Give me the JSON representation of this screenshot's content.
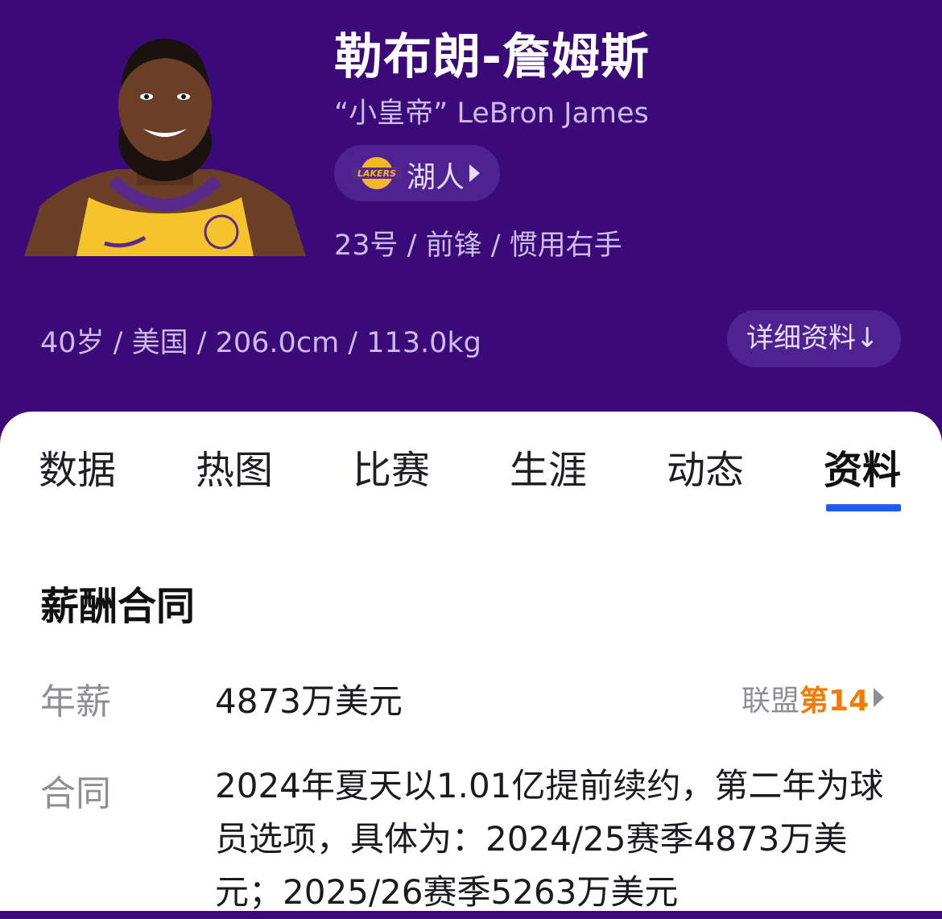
{
  "player": {
    "name": "勒布朗-詹姆斯",
    "nickname": "“小皇帝” LeBron James",
    "team": "湖人",
    "team_logo": "lakers-logo",
    "meta_position": "23号 / 前锋 / 惯用右手",
    "meta_bio": "40岁 / 美国 / 206.0cm / 113.0kg",
    "details_button": "详细资料↓"
  },
  "tabs": [
    {
      "label": "数据"
    },
    {
      "label": "热图"
    },
    {
      "label": "比赛"
    },
    {
      "label": "生涯"
    },
    {
      "label": "动态"
    },
    {
      "label": "资料",
      "active": true
    }
  ],
  "salary": {
    "section_title": "薪酬合同",
    "annual_label": "年薪",
    "annual_value": "4873万美元",
    "rank_prefix": "联盟",
    "rank_value": "第14",
    "contract_label": "合同",
    "contract_text": "2024年夏天以1.01亿提前续约，第二年为球员选项，具体为：2024/25赛季4873万美元；2025/26赛季5263万美元"
  },
  "colors": {
    "header_bg": "#3b0a78",
    "pill_bg": "#4e2391",
    "tab_underline": "#1f5cf0",
    "rank_highlight": "#f47a00"
  }
}
